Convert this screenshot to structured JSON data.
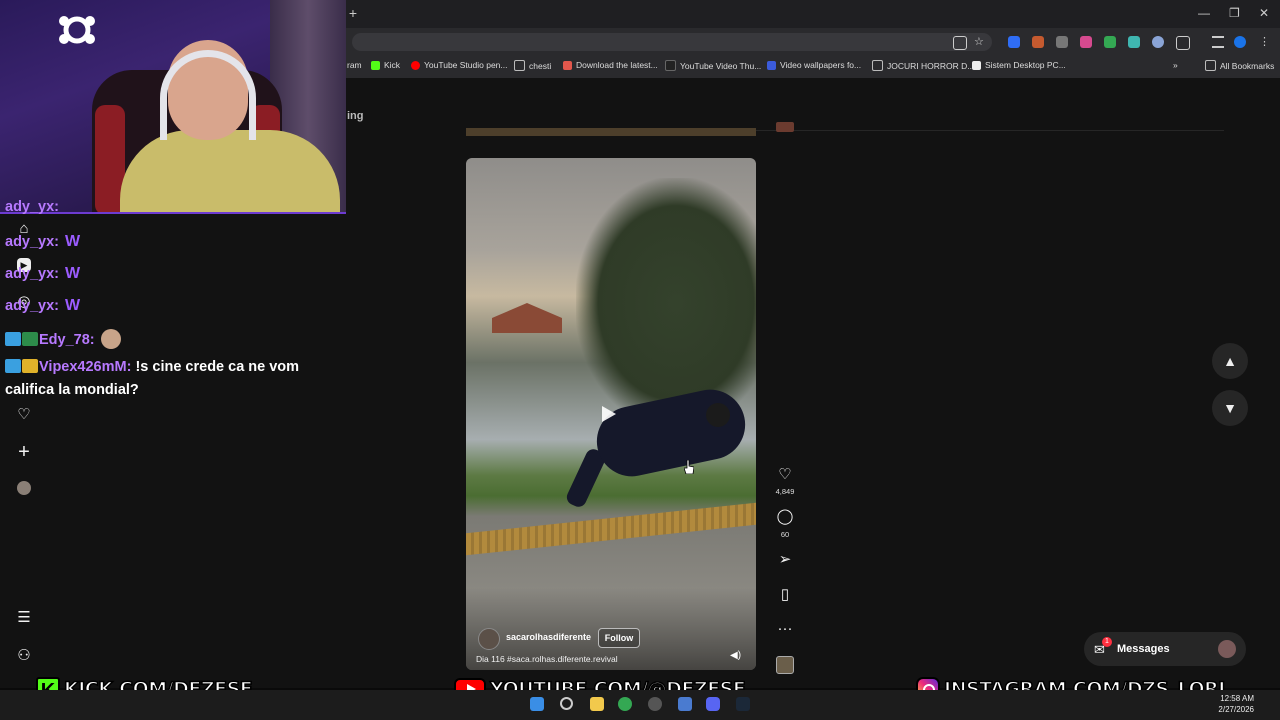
{
  "browser": {
    "bookmarks": [
      {
        "label": "ram",
        "color": "#000000"
      },
      {
        "label": "Kick",
        "color": "#53fc18"
      },
      {
        "label": "YouTube Studio pen...",
        "color": "#ff0000"
      },
      {
        "label": "chesti",
        "color": "#888888"
      },
      {
        "label": "Download the latest...",
        "color": "#e2574c"
      },
      {
        "label": "YouTube Video Thu...",
        "color": "#222222"
      },
      {
        "label": "Video wallpapers fo...",
        "color": "#3b5bdb"
      },
      {
        "label": "JOCURI HORROR D...",
        "color": "#888888"
      },
      {
        "label": "Sistem Desktop PC...",
        "color": "#eeeeee"
      }
    ],
    "all_bookmarks": "All Bookmarks",
    "tab_fragment": "ing"
  },
  "chat": {
    "messages": [
      {
        "user": "ady_yx:",
        "text": "",
        "emote": "W"
      },
      {
        "user": "ady_yx:",
        "text": "",
        "emote": "W"
      },
      {
        "user": "ady_yx:",
        "text": "",
        "emote": "W"
      },
      {
        "user": "ady_yx:",
        "text": "",
        "emote": "W"
      },
      {
        "user": "Edy_78:",
        "text": "",
        "emote": ""
      },
      {
        "user": "Vipex426mM:",
        "text": "!s cine crede ca ne vom",
        "emote": ""
      }
    ],
    "continuation": "califica la mondial?"
  },
  "post": {
    "author": "sacarolhasdiferente",
    "follow_label": "Follow",
    "caption": "Dia 116 #saca.rolhas.diferente.revival",
    "likes": "4,849",
    "comments": "60"
  },
  "messages_button": {
    "label": "Messages",
    "badge": "1"
  },
  "overlay": {
    "kick": "KICK.COM/DEZESE",
    "youtube": "YOUTUBE.COM/@DEZESE",
    "instagram": "INSTAGRAM.COM/DZS_LORI"
  },
  "taskbar": {
    "time": "12:58 AM",
    "date": "2/27/2026"
  },
  "icons": {
    "rail": [
      "home-icon",
      "reels-icon",
      "explore-icon",
      "notifications-heart-icon",
      "create-plus-icon",
      "profile-avatar",
      "menu-hamburger-icon",
      "apps-grid-icon"
    ],
    "actions": [
      "like-heart-icon",
      "comment-icon",
      "share-send-icon",
      "save-bookmark-icon",
      "more-options-icon"
    ]
  },
  "colors": {
    "kick_green": "#53fc18",
    "chat_user": "#b779ff",
    "instagram_badge": "#ff3040"
  }
}
